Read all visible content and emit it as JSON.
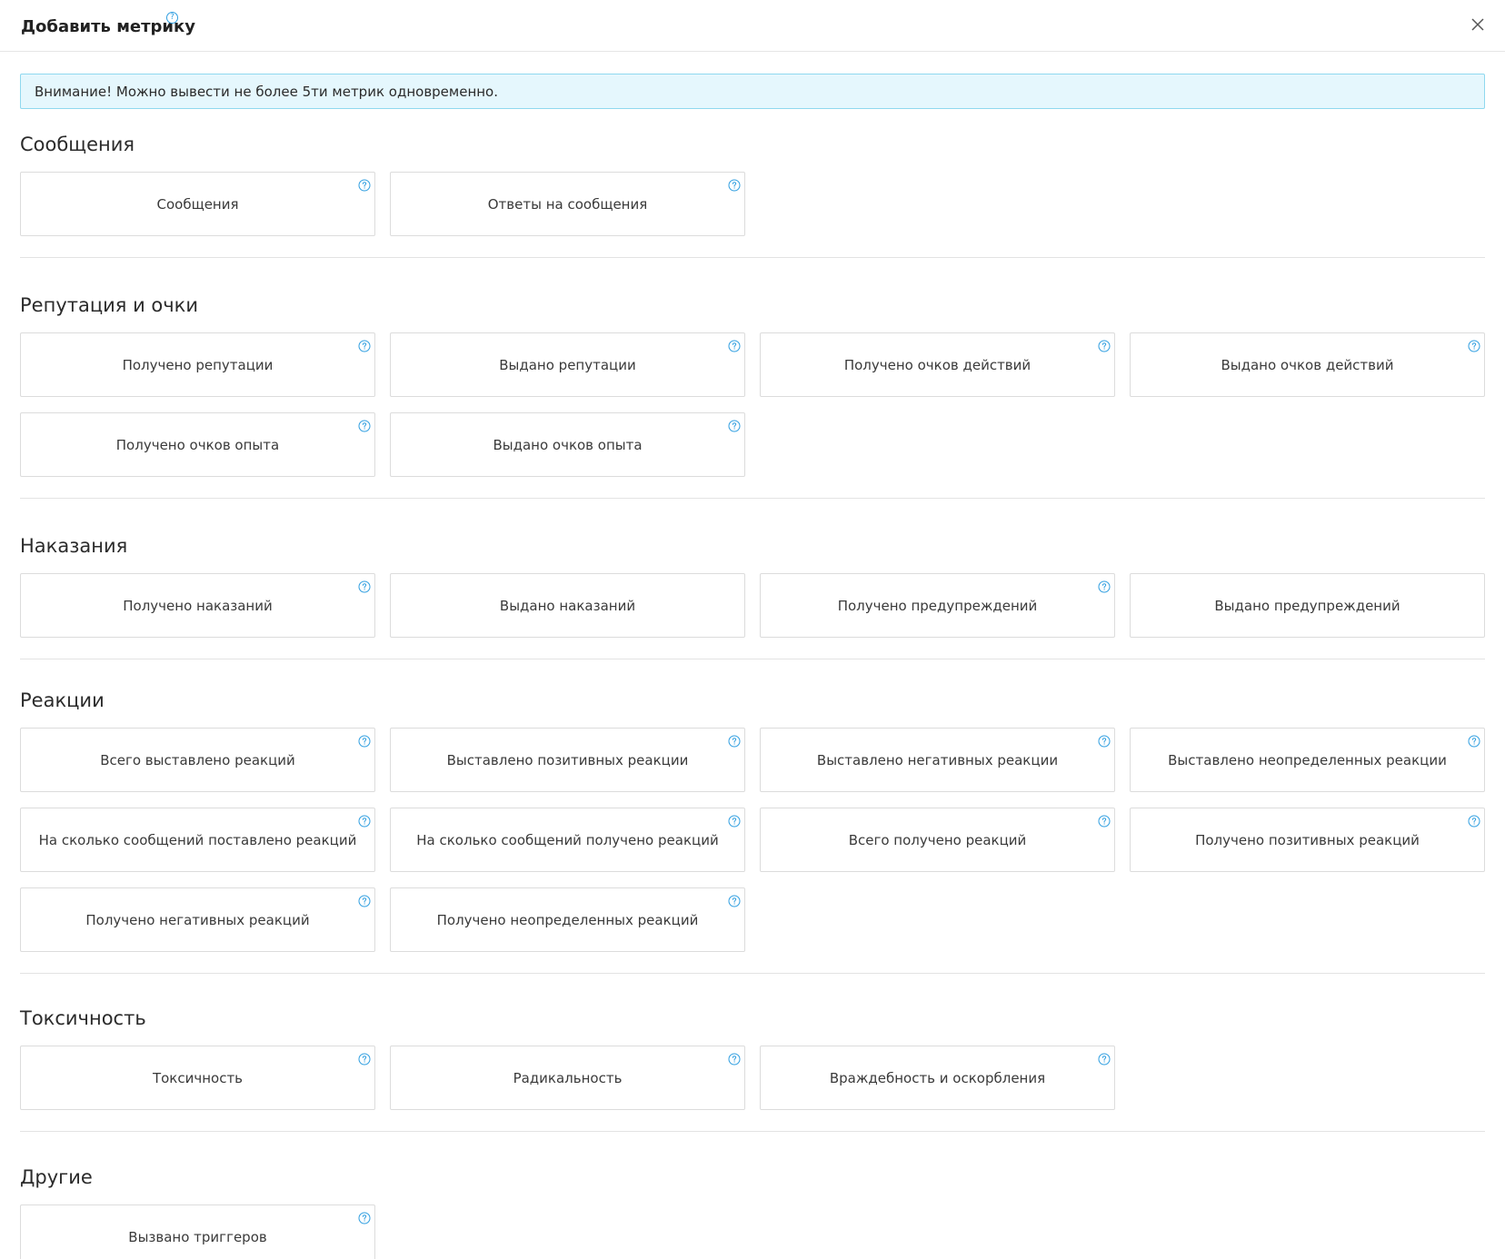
{
  "modal": {
    "title": "Добавить метрику",
    "help_icon": "question-circle-icon",
    "close_icon": "close-icon"
  },
  "alert": {
    "text": "Внимание! Можно вывести не более 5ти метрик одновременно."
  },
  "colors": {
    "accent": "#2f9ee0",
    "alert_bg": "#e5f7fd",
    "alert_border": "#8fd8ef",
    "card_border": "#dcdcdc"
  },
  "sections": [
    {
      "title": "Сообщения",
      "metrics": [
        {
          "label": "Сообщения",
          "help": true
        },
        {
          "label": "Ответы на сообщения",
          "help": true
        }
      ]
    },
    {
      "title": "Репутация и очки",
      "metrics": [
        {
          "label": "Получено репутации",
          "help": true
        },
        {
          "label": "Выдано репутации",
          "help": true
        },
        {
          "label": "Получено очков действий",
          "help": true
        },
        {
          "label": "Выдано очков действий",
          "help": true
        },
        {
          "label": "Получено очков опыта",
          "help": true
        },
        {
          "label": "Выдано очков опыта",
          "help": true
        }
      ]
    },
    {
      "title": "Наказания",
      "metrics": [
        {
          "label": "Получено наказаний",
          "help": true
        },
        {
          "label": "Выдано наказаний",
          "help": false
        },
        {
          "label": "Получено предупреждений",
          "help": true
        },
        {
          "label": "Выдано предупреждений",
          "help": false
        }
      ]
    },
    {
      "title": "Реакции",
      "metrics": [
        {
          "label": "Всего выставлено реакций",
          "help": true
        },
        {
          "label": "Выставлено позитивных реакции",
          "help": true
        },
        {
          "label": "Выставлено негативных реакции",
          "help": true
        },
        {
          "label": "Выставлено неопределенных реакции",
          "help": true
        },
        {
          "label": "На сколько сообщений поставлено реакций",
          "help": true
        },
        {
          "label": "На сколько сообщений получено реакций",
          "help": true
        },
        {
          "label": "Всего получено реакций",
          "help": true
        },
        {
          "label": "Получено позитивных реакций",
          "help": true
        },
        {
          "label": "Получено негативных реакций",
          "help": true
        },
        {
          "label": "Получено неопределенных реакций",
          "help": true
        }
      ]
    },
    {
      "title": "Токсичность",
      "metrics": [
        {
          "label": "Токсичность",
          "help": true
        },
        {
          "label": "Радикальность",
          "help": true
        },
        {
          "label": "Враждебность и оскорбления",
          "help": true
        }
      ]
    },
    {
      "title": "Другие",
      "metrics": [
        {
          "label": "Вызвано триггеров",
          "help": true
        }
      ]
    }
  ]
}
